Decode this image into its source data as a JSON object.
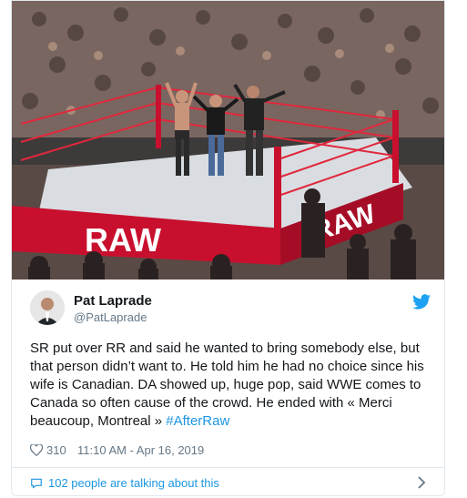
{
  "user": {
    "name": "Pat Laprade",
    "handle": "@PatLaprade"
  },
  "photo": {
    "apron_left_text": "RAW",
    "apron_right_text": "RAW"
  },
  "tweet": {
    "text_main": "SR put over RR and said he wanted to bring somebody else, but that person didn’t want to. He told him he had no choice since his wife is Canadian. DA showed up, huge pop, said WWE comes to Canada so often cause of the crowd. He ended with « Merci beaucoup, Montreal » ",
    "hashtag": "#AfterRaw"
  },
  "meta": {
    "likes": "310",
    "timestamp": "11:10 AM - Apr 16, 2019"
  },
  "footer": {
    "talking": "102 people are talking about this"
  },
  "colors": {
    "accent": "#1b95e0",
    "raw_red": "#c8102e",
    "text": "#14171a",
    "muted": "#657786"
  },
  "icons": {
    "brand": "twitter-bird-icon",
    "like": "heart-icon",
    "reply": "speech-bubble-icon",
    "more": "chevron-right-icon"
  }
}
